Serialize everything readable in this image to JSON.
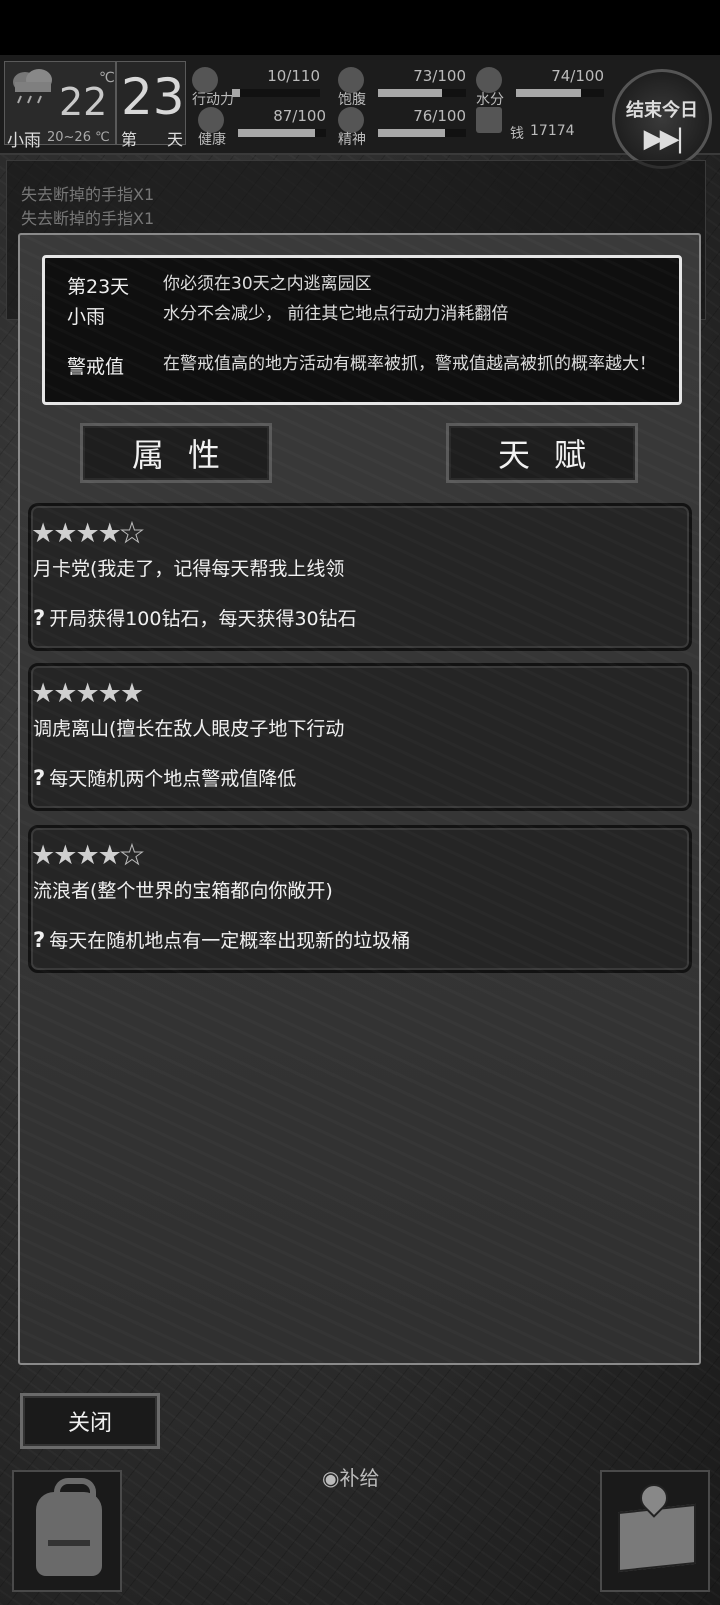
{
  "status": {
    "weather_name": "小雨",
    "temp_now": "22",
    "temp_unit": "℃",
    "temp_range": "20~26 ℃",
    "day_number": "23",
    "day_label_1": "第",
    "day_label_2": "天",
    "stats": [
      {
        "name": "行动力",
        "value": "10/110",
        "fraction": 0.09,
        "icon": "footprint-icon"
      },
      {
        "name": "饱腹",
        "value": "73/100",
        "fraction": 0.73,
        "icon": "stomach-icon"
      },
      {
        "name": "水分",
        "value": "74/100",
        "fraction": 0.74,
        "icon": "water-drop-icon"
      },
      {
        "name": "健康",
        "value": "87/100",
        "fraction": 0.87,
        "icon": "medkit-icon"
      },
      {
        "name": "精神",
        "value": "76/100",
        "fraction": 0.76,
        "icon": "brain-icon"
      }
    ],
    "money_label": "钱",
    "money_value": "17174",
    "end_day_label": "结束今日",
    "end_day_arrows": "▶▶|"
  },
  "log": {
    "lines": [
      "失去断掉的手指X1",
      "失去断掉的手指X1"
    ]
  },
  "info": {
    "day_title": "第23天",
    "day_desc": "你必须在30天之内逃离园区",
    "weather_title": "小雨",
    "weather_desc": "水分不会减少， 前往其它地点行动力消耗翻倍",
    "alert_title": "警戒值",
    "alert_desc": "在警戒值高的地方活动有概率被抓，警戒值越高被抓的概率越大！"
  },
  "tabs": {
    "attributes": "属性",
    "talents": "天赋"
  },
  "talents": [
    {
      "stars": 4,
      "max": 5,
      "name": "月卡党(我走了，记得每天帮我上线领",
      "desc": "开局获得100钻石，每天获得30钻石"
    },
    {
      "stars": 5,
      "max": 5,
      "name": "调虎离山(擅长在敌人眼皮子地下行动",
      "desc": "每天随机两个地点警戒值降低"
    },
    {
      "stars": 4,
      "max": 5,
      "name": "流浪者(整个世界的宝箱都向你敞开)",
      "desc": "每天在随机地点有一定概率出现新的垃圾桶"
    }
  ],
  "close_label": "关闭",
  "supply_label": "◉补给"
}
